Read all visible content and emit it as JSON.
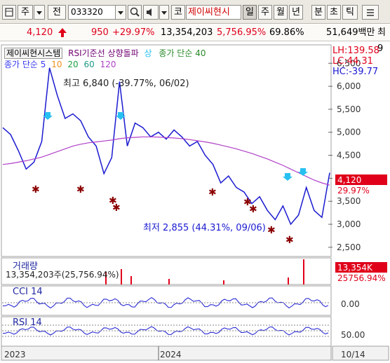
{
  "toolbar": {
    "layout_icon": "layout-icon",
    "market_label": "주",
    "period_label": "전",
    "stock_code": "033320",
    "search_icon": "search-icon",
    "sound_icon": "speaker-icon",
    "market_tag": "코",
    "stock_name": "제이씨현시",
    "period_tabs": [
      "일",
      "주",
      "월",
      "년",
      "분",
      "초",
      "틱"
    ],
    "active_period": "일"
  },
  "price_bar": {
    "price": "4,120",
    "change": "950",
    "change_pct": "+29.97%",
    "volume": "13,354,203",
    "volume_ratio": "5,756.95%",
    "turnover": "69.86%",
    "trade_value": "51,649백만",
    "extra": "최9"
  },
  "legend": {
    "row1": [
      "제이씨현시스템",
      "RSI기준선 상향돌파",
      "상",
      "종가 단순 40"
    ],
    "row2_prefix": "종가 단순 5",
    "row2_values": [
      "10",
      "20",
      "60",
      "120"
    ]
  },
  "stats": {
    "lh": "LH:139.58",
    "lc": "LC:44.31",
    "hc": "HC:-39.77"
  },
  "annotations": {
    "high": "최고 6,840 (-39.77%, 06/02)",
    "low": "최저 2,855 (44.31%, 09/06)"
  },
  "price_axis": {
    "ticks": [
      "6,500",
      "6,000",
      "5,500",
      "5,000",
      "4,500",
      "4,000",
      "3,500",
      "3,000",
      "2,500"
    ],
    "current_price_badge": "4,120",
    "current_pct_badge": "29.97%"
  },
  "volume_panel": {
    "label": "거래량",
    "value_text": "13,354,203주(25,756.94%)",
    "badge": "13,354K",
    "badge2": "25756.94%"
  },
  "cci_panel": {
    "label": "CCI 14",
    "tick": "0.00"
  },
  "rsi_panel": {
    "label": "RSI 14",
    "tick": "50.00"
  },
  "time_axis": {
    "labels": [
      "2023",
      "2024",
      "10/14"
    ]
  },
  "colors": {
    "candle_up": "#e0001a",
    "candle_down": "#1a1ad0",
    "ma5": "#3a3af0",
    "ma10": "#f09020",
    "ma20": "#20a040",
    "ma40": "#2a8a2a",
    "ma60": "#1f9a8a",
    "ma120": "#b040c8",
    "signal_arrow": "#28c0f0",
    "marker": "#8b0000"
  },
  "chart_data": {
    "type": "line",
    "x_labels": [
      "2023",
      "2024"
    ],
    "ylim": [
      2300,
      6900
    ],
    "y_ticks": [
      6500,
      6000,
      5500,
      5000,
      4500,
      4000,
      3500,
      3000,
      2500
    ],
    "series": [
      {
        "name": "종가",
        "values": [
          5100,
          4950,
          4600,
          4200,
          4350,
          4800,
          6400,
          5800,
          5300,
          5400,
          5250,
          4900,
          4700,
          4100,
          4450,
          6100,
          4700,
          5200,
          5100,
          4900,
          5000,
          4850,
          5050,
          4900,
          4700,
          4800,
          4500,
          4300,
          3900,
          4050,
          3800,
          3700,
          3450,
          3600,
          3300,
          3100,
          3400,
          3000,
          3200,
          3800,
          3300,
          3150,
          4120
        ]
      },
      {
        "name": "종가 단순 120",
        "values": [
          4300,
          4320,
          4350,
          4380,
          4420,
          4460,
          4520,
          4580,
          4640,
          4700,
          4740,
          4770,
          4790,
          4810,
          4830,
          4860,
          4880,
          4890,
          4900,
          4900,
          4895,
          4885,
          4875,
          4860,
          4840,
          4815,
          4790,
          4760,
          4720,
          4680,
          4640,
          4590,
          4540,
          4480,
          4420,
          4350,
          4280,
          4200,
          4120,
          4040,
          3960,
          3900,
          3850
        ]
      }
    ]
  }
}
